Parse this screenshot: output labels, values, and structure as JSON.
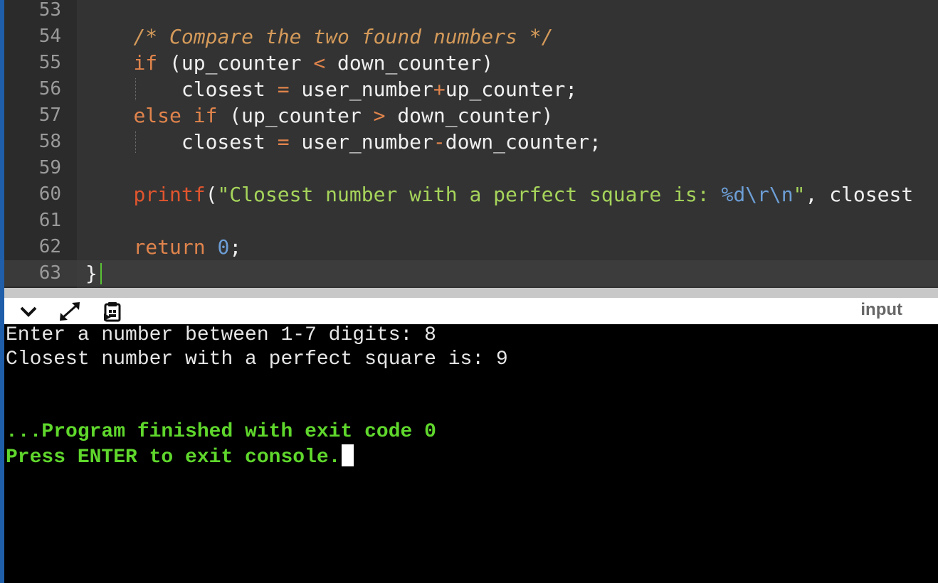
{
  "editor": {
    "line_numbers": [
      "53",
      "54",
      "55",
      "56",
      "57",
      "58",
      "59",
      "60",
      "61",
      "62",
      "63"
    ],
    "active_line": "63",
    "lines": [
      {
        "num": "53",
        "tokens": []
      },
      {
        "num": "54",
        "tokens": [
          {
            "t": "    "
          },
          {
            "t": "/* Compare the two found numbers */",
            "c": "comment"
          }
        ]
      },
      {
        "num": "55",
        "tokens": [
          {
            "t": "    "
          },
          {
            "t": "if",
            "c": "keyword"
          },
          {
            "t": " (up_counter "
          },
          {
            "t": "<",
            "c": "op"
          },
          {
            "t": " down_counter)"
          }
        ]
      },
      {
        "num": "56",
        "tokens": [
          {
            "t": "        closest "
          },
          {
            "t": "=",
            "c": "op"
          },
          {
            "t": " user_number"
          },
          {
            "t": "+",
            "c": "op"
          },
          {
            "t": "up_counter;"
          }
        ]
      },
      {
        "num": "57",
        "tokens": [
          {
            "t": "    "
          },
          {
            "t": "else if",
            "c": "keyword"
          },
          {
            "t": " (up_counter "
          },
          {
            "t": ">",
            "c": "op"
          },
          {
            "t": " down_counter)"
          }
        ]
      },
      {
        "num": "58",
        "tokens": [
          {
            "t": "        closest "
          },
          {
            "t": "=",
            "c": "op"
          },
          {
            "t": " user_number"
          },
          {
            "t": "-",
            "c": "op"
          },
          {
            "t": "down_counter;"
          }
        ]
      },
      {
        "num": "59",
        "tokens": []
      },
      {
        "num": "60",
        "tokens": [
          {
            "t": "    "
          },
          {
            "t": "printf",
            "c": "func"
          },
          {
            "t": "("
          },
          {
            "t": "\"Closest number with a perfect square is: ",
            "c": "string"
          },
          {
            "t": "%d\\r\\n",
            "c": "escape"
          },
          {
            "t": "\"",
            "c": "string"
          },
          {
            "t": ", closest"
          }
        ]
      },
      {
        "num": "61",
        "tokens": []
      },
      {
        "num": "62",
        "tokens": [
          {
            "t": "    "
          },
          {
            "t": "return",
            "c": "keyword"
          },
          {
            "t": " "
          },
          {
            "t": "0",
            "c": "number"
          },
          {
            "t": ";"
          }
        ]
      },
      {
        "num": "63",
        "tokens": [
          {
            "t": "}"
          }
        ]
      }
    ]
  },
  "toolbar": {
    "collapse_icon": "chevron-down-icon",
    "expand_icon": "expand-arrows-icon",
    "clipboard_icon": "clipboard-icon",
    "input_label": "input"
  },
  "console": {
    "lines": [
      {
        "text": "Enter a number between 1-7 digits: 8",
        "style": "out"
      },
      {
        "text": "Closest number with a perfect square is: 9",
        "style": "out"
      },
      {
        "text": "",
        "style": "out"
      },
      {
        "text": "",
        "style": "out"
      },
      {
        "text": "...Program finished with exit code 0",
        "style": "green"
      },
      {
        "text": "Press ENTER to exit console.",
        "style": "green"
      }
    ]
  },
  "colors": {
    "comment": "#d49a5a",
    "keyword": "#e0844c",
    "op": "#e0844c",
    "func": "#e0552e",
    "string": "#a6d45b",
    "escape": "#6d9ed6",
    "number": "#6d9ed6",
    "default": "#f0f0f0",
    "console_green": "#5fd72c",
    "gutter_bg": "#2b2b2b",
    "editor_bg": "#333333"
  }
}
